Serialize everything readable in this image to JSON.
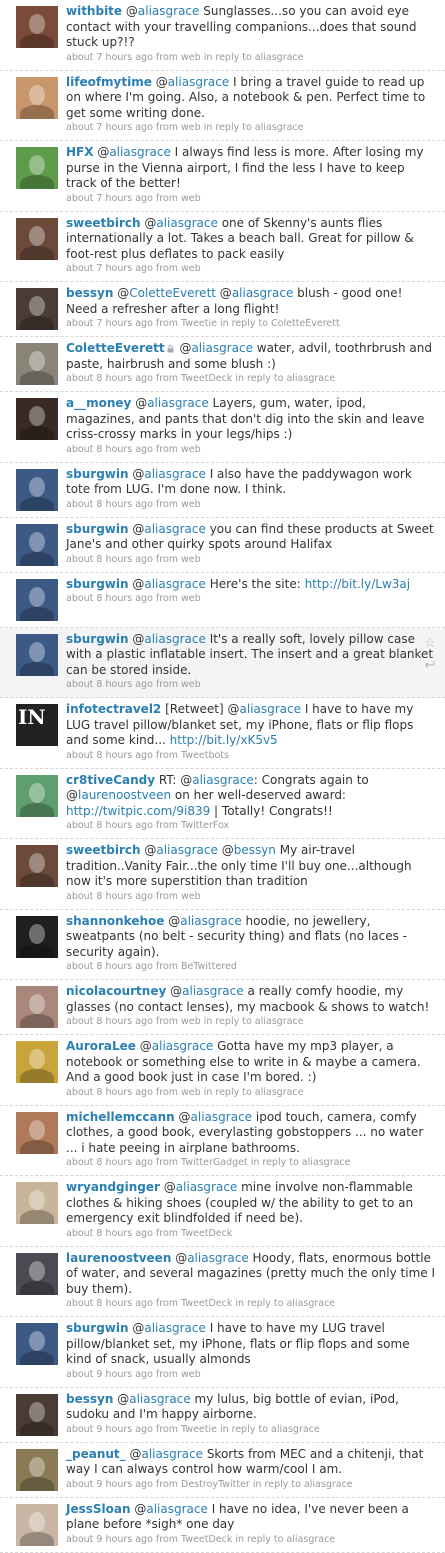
{
  "tweets": [
    {
      "user": "withbite",
      "text": "@aliasgrace Sunglasses...so you can avoid eye contact with your travelling companions...does that sound stuck up?!?",
      "meta": "about 7 hours ago from web in reply to aliasgrace",
      "avatar_color": "#7a4b3a"
    },
    {
      "user": "lifeofmytime",
      "text": "@aliasgrace I bring a travel guide to read up on where I'm going. Also, a notebook & pen. Perfect time to get some writing done.",
      "meta": "about 7 hours ago from web in reply to aliasgrace",
      "avatar_color": "#c9956a"
    },
    {
      "user": "HFX",
      "text": "@aliasgrace I always find less is more. After losing my purse in the Vienna airport, I find the less I have to keep track of the better!",
      "meta": "about 7 hours ago from web",
      "avatar_color": "#5d9c4a"
    },
    {
      "user": "sweetbirch",
      "text": "@aliasgrace one of Skenny's aunts flies internationally a lot. Takes a beach ball. Great for pillow & foot-rest plus deflates to pack easily",
      "meta": "about 7 hours ago from web",
      "avatar_color": "#6b4a3a"
    },
    {
      "user": "bessyn",
      "text": "@ColetteEverett @aliasgrace blush - good one! Need a refresher after a long flight!",
      "meta": "about 7 hours ago from Tweetie in reply to ColetteEverett",
      "avatar_color": "#4a3b34"
    },
    {
      "user": "ColetteEverett",
      "text": "@aliasgrace water, advil, toothrbrush and paste, hairbrush and some blush :)",
      "meta": "about 8 hours ago from TweetDeck in reply to aliasgrace",
      "avatar_color": "#8a8478",
      "locked": true
    },
    {
      "user": "a__money",
      "text": "@aliasgrace Layers, gum, water, ipod, magazines, and pants that don't dig into the skin and leave criss-crossy marks in your legs/hips :)",
      "meta": "about 8 hours ago from web",
      "avatar_color": "#3a2a24"
    },
    {
      "user": "sburgwin",
      "text": "@aliasgrace I also have the paddywagon work tote from LUG. I'm done now. I think.",
      "meta": "about 8 hours ago from web",
      "avatar_color": "#3d5a86"
    },
    {
      "user": "sburgwin",
      "text": "@aliasgrace you can find these products at Sweet Jane's and other quirky spots around Halifax",
      "meta": "about 8 hours ago from web",
      "avatar_color": "#3d5a86"
    },
    {
      "user": "sburgwin",
      "text": "@aliasgrace Here's the site: ",
      "link": "http://bit.ly/Lw3aj",
      "meta": "about 8 hours ago from web",
      "avatar_color": "#3d5a86"
    },
    {
      "user": "sburgwin",
      "text": "@aliasgrace It's a really soft, lovely pillow case with a plastic inflatable insert. The insert and a great blanket can be stored inside.",
      "meta": "about 8 hours ago from web",
      "avatar_color": "#3d5a86",
      "highlight": true
    },
    {
      "user": "infotectravel2",
      "text": "[Retweet] @aliasgrace I have to have my LUG travel pillow/blanket set, my iPhone, flats or flip flops and some kind... ",
      "link": "http://bit.ly/xK5v5",
      "meta": "about 8 hours ago from Tweetbots",
      "avatar_color": "#222222",
      "avatar_text": "IN"
    },
    {
      "user": "cr8tiveCandy",
      "text": "RT: @aliasgrace: Congrats again to @laurenoostveen on her well-deserved award: ",
      "link": "http://twitpic.com/9i839",
      "text_after": " | Totally! Congrats!!",
      "meta": "about 8 hours ago from TwitterFox",
      "avatar_color": "#5f9e6e"
    },
    {
      "user": "sweetbirch",
      "text": "@aliasgrace @bessyn My air-travel tradition..Vanity Fair...the only time I'll buy one...although now it's more superstition than tradition",
      "meta": "about 8 hours ago from web",
      "avatar_color": "#6b4a3a"
    },
    {
      "user": "shannonkehoe",
      "text": "@aliasgrace hoodie, no jewellery, sweatpants (no belt - security thing) and flats (no laces - security again).",
      "meta": "about 8 hours ago from BeTwittered",
      "avatar_color": "#1f1f1f"
    },
    {
      "user": "nicolacourtney",
      "text": "@aliasgrace a really comfy hoodie, my glasses (no contact lenses), my macbook & shows to watch!",
      "meta": "about 8 hours ago from web in reply to aliasgrace",
      "avatar_color": "#a9877a"
    },
    {
      "user": "AuroraLee",
      "text": "@aliasgrace Gotta have my mp3 player, a notebook or something else to write in & maybe a camera. And a good book just in case I'm bored. :)",
      "meta": "about 8 hours ago from web in reply to aliasgrace",
      "avatar_color": "#c9a43a"
    },
    {
      "user": "michellemccann",
      "text": "@aliasgrace ipod touch, camera, comfy clothes, a good book, everylasting gobstoppers ... no water ... i hate peeing in airplane bathrooms.",
      "meta": "about 8 hours ago from TwitterGadget in reply to aliasgrace",
      "avatar_color": "#b07a5a"
    },
    {
      "user": "wryandginger",
      "text": "@aliasgrace mine involve non-flammable clothes & hiking shoes (coupled w/ the ability to get to an emergency exit blindfolded if need be).",
      "meta": "about 8 hours ago from TweetDeck",
      "avatar_color": "#c8b49a"
    },
    {
      "user": "laurenoostveen",
      "text": "@aliasgrace Hoody, flats, enormous bottle of water, and several magazines (pretty much the only time I buy them).",
      "meta": "about 8 hours ago from TweetDeck in reply to aliasgrace",
      "avatar_color": "#4a4a52"
    },
    {
      "user": "sburgwin",
      "text": "@aliasgrace I have to have my LUG travel pillow/blanket set, my iPhone, flats or flip flops and some kind of snack, usually almonds",
      "meta": "about 9 hours ago from web",
      "avatar_color": "#3d5a86"
    },
    {
      "user": "bessyn",
      "text": "@aliasgrace my lulus, big bottle of evian, iPod, sudoku and I'm happy airborne.",
      "meta": "about 9 hours ago from Tweetie in reply to aliasgrace",
      "avatar_color": "#4a3b34"
    },
    {
      "user": "_peanut_",
      "text": "@aliasgrace Skorts from MEC and a chitenji, that way I can always control how warm/cool I am.",
      "meta": "about 9 hours ago from DestroyTwitter in reply to aliasgrace",
      "avatar_color": "#8a7b56"
    },
    {
      "user": "JessSloan",
      "text": "@aliasgrace I have no idea, I've never been a plane before *sigh* one day",
      "meta": "about 9 hours ago from TweetDeck in reply to aliasgrace",
      "avatar_color": "#c9b6a4"
    }
  ],
  "actions": {
    "favorite_icon": "☆",
    "reply_icon": "↩"
  }
}
